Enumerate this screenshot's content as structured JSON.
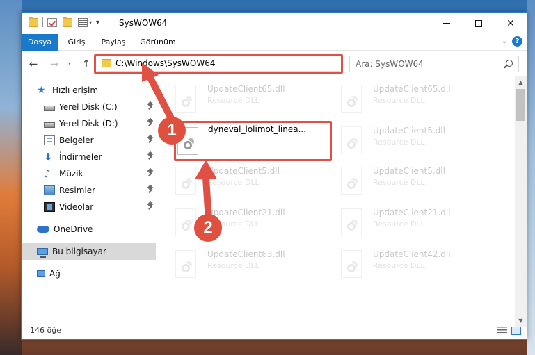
{
  "window": {
    "title": "SysWOW64"
  },
  "ribbon": {
    "tabs": [
      {
        "label": "Dosya"
      },
      {
        "label": "Giriş"
      },
      {
        "label": "Paylaş"
      },
      {
        "label": "Görünüm"
      }
    ],
    "help_label": "?"
  },
  "address": {
    "path": "C:\\Windows\\SysWOW64",
    "search_placeholder": "Ara: SysWOW64"
  },
  "sidebar": {
    "items": [
      {
        "label": "Hızlı erişim",
        "icon": "star-icon"
      },
      {
        "label": "Yerel Disk (C:)",
        "icon": "disk-icon",
        "pinned": true
      },
      {
        "label": "Yerel Disk (D:)",
        "icon": "disk-icon",
        "pinned": true
      },
      {
        "label": "Belgeler",
        "icon": "document-icon",
        "pinned": true
      },
      {
        "label": "İndirmeler",
        "icon": "download-icon",
        "pinned": true
      },
      {
        "label": "Müzik",
        "icon": "music-icon",
        "pinned": true
      },
      {
        "label": "Resimler",
        "icon": "picture-icon",
        "pinned": true
      },
      {
        "label": "Videolar",
        "icon": "video-icon",
        "pinned": true
      },
      {
        "label": "OneDrive",
        "icon": "cloud-icon"
      },
      {
        "label": "Bu bilgisayar",
        "icon": "computer-icon",
        "selected": true
      },
      {
        "label": "Ağ",
        "icon": "network-icon"
      }
    ]
  },
  "files": {
    "highlighted": {
      "name": "dyneval_lolimot_linea...",
      "type": ""
    },
    "faded": [
      {
        "name": "UpdateClient65.dll",
        "type": "Resource DLL"
      },
      {
        "name": "UpdateClient65.dll",
        "type": "Resource DLL"
      },
      {
        "name": "UpdateClient5.dll",
        "type": "Resource DLL"
      },
      {
        "name": "UpdateClient5.dll",
        "type": "Resource DLL"
      },
      {
        "name": "UpdateClient5.dll",
        "type": "Resource DLL"
      },
      {
        "name": "UpdateClient21.dll",
        "type": "Resource DLL"
      },
      {
        "name": "UpdateClient21.dll",
        "type": "Resource DLL"
      },
      {
        "name": "UpdateClient63.dll",
        "type": "Resource DLL"
      },
      {
        "name": "UpdateClient42.dll",
        "type": "Resource DLL"
      }
    ]
  },
  "status": {
    "count": "146 öğe"
  },
  "annotations": {
    "badge1": "1",
    "badge2": "2",
    "color": "#e05045"
  },
  "colors": {
    "accent": "#1979ca",
    "selected_bg": "#d9d9d9"
  }
}
